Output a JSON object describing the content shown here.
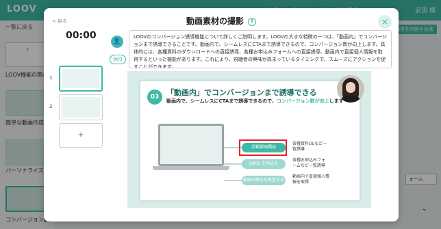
{
  "app": {
    "logo": "LOOV",
    "top_links": "サポートサイト　　サービス紹介",
    "user": "安田 様",
    "back_label": "一覧に戻る",
    "help_label": "?",
    "list_items": [
      "LOOV機能の関心",
      "簡単な動画作成機",
      "パーソナライズ機",
      "コンバージョン誘"
    ],
    "action_button": "回答を内容を反映",
    "select_value": "ォーム"
  },
  "modal": {
    "back": "< 戻る",
    "title": "動画素材の撮影",
    "help_icon": "?",
    "timer": "00:00",
    "slides": [
      {
        "num": "1"
      },
      {
        "num": "2"
      }
    ],
    "add_slide": "+",
    "break_button": "休符",
    "script_text": "LOOVのコンバージョン誘導機能について詳しくご説明します。LOOVの大きな特徴の一つは、「動画内」でコンバージョンまで誘導できることです。動画内で、シームレスにCTAまで誘導できるので、コンバージョン数が向上します。具体的には、各種資料のダウンロードへの直接誘導、各種お申込みフォームへの直接誘導、動画内で直接個人情報を取得するといった機能があります。これにより、視聴者の興味が高まっているタイミングで、スムーズにアクションを促すことができます。"
  },
  "preview": {
    "number": "03",
    "title": "「動画内」でコンバージョンまで誘導できる",
    "subtitle_pre": "動画内で、シームレスにCTAまで誘導できるので、",
    "subtitle_accent": "コンバージョン数が向上",
    "subtitle_post": "します",
    "buttons": [
      "手動録画開始",
      "SMSS を申込み",
      "動画の続きを再生する"
    ],
    "notes": [
      "各種資料DLなど一覧誘導",
      "各種お申込みフォームなど一覧誘導",
      "動画内で直接個人情報を取得"
    ]
  },
  "colors": {
    "accent": "#3fb8a6",
    "highlight": "#e0262a"
  }
}
